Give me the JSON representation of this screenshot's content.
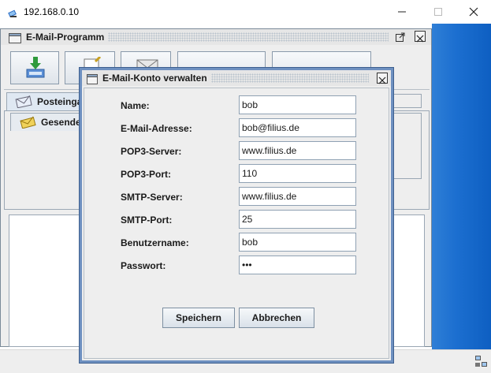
{
  "os_window": {
    "title": "192.168.0.10",
    "icons": {
      "app": "network-computer-icon",
      "minimize": "minimize-icon",
      "maximize": "maximize-icon",
      "close": "close-icon",
      "tray": "network-tray-icon"
    }
  },
  "mail_program": {
    "title": "E-Mail-Programm",
    "tabs": [
      {
        "label": "Posteingang",
        "icon": "inbox-envelope-icon"
      },
      {
        "label": "Gesendete",
        "icon": "sent-envelope-icon"
      }
    ],
    "toolbar_icons": [
      "download-mail-icon",
      "compose-mail-icon",
      "envelope-icon"
    ]
  },
  "dialog": {
    "title": "E-Mail-Konto verwalten",
    "fields": [
      {
        "label": "Name:",
        "value": "bob"
      },
      {
        "label": "E-Mail-Adresse:",
        "value": "bob@filius.de"
      },
      {
        "label": "POP3-Server:",
        "value": "www.filius.de"
      },
      {
        "label": "POP3-Port:",
        "value": "110"
      },
      {
        "label": "SMTP-Server:",
        "value": "www.filius.de"
      },
      {
        "label": "SMTP-Port:",
        "value": "25"
      },
      {
        "label": "Benutzername:",
        "value": "bob"
      },
      {
        "label": "Passwort:",
        "value": "•••"
      }
    ],
    "buttons": {
      "save": "Speichern",
      "cancel": "Abbrechen"
    }
  },
  "colors": {
    "desktop_accent": "#1c6fd0",
    "dialog_border": "#6e90c0",
    "panel_bg": "#eeeeee"
  }
}
